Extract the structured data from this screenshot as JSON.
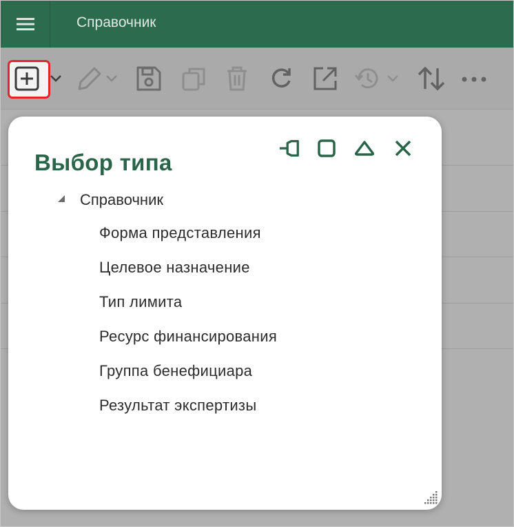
{
  "header": {
    "title": "Справочник"
  },
  "toolbar": {
    "buttons": [
      {
        "name": "add",
        "icon": "add-square-icon"
      },
      {
        "name": "edit",
        "icon": "pencil-icon"
      },
      {
        "name": "save",
        "icon": "floppy-icon"
      },
      {
        "name": "copy",
        "icon": "copy-icon"
      },
      {
        "name": "delete",
        "icon": "trash-icon"
      },
      {
        "name": "refresh",
        "icon": "refresh-icon"
      },
      {
        "name": "open-external",
        "icon": "external-link-icon"
      },
      {
        "name": "history",
        "icon": "history-icon"
      },
      {
        "name": "sort",
        "icon": "sort-arrows-icon"
      },
      {
        "name": "more",
        "icon": "more-dots-icon"
      }
    ]
  },
  "dialog": {
    "title": "Выбор типа",
    "controls": [
      "pin-icon",
      "maximize-icon",
      "collapse-icon",
      "close-icon"
    ],
    "tree": {
      "root": "Справочник",
      "items": [
        "Форма представления",
        "Целевое назначение",
        "Тип лимита",
        "Ресурс финансирования",
        "Группа бенефициара",
        "Результат экспертизы"
      ]
    }
  },
  "colors": {
    "brand": "#2c6b4e",
    "highlight": "#e3242b",
    "title_text": "#2a6449"
  }
}
